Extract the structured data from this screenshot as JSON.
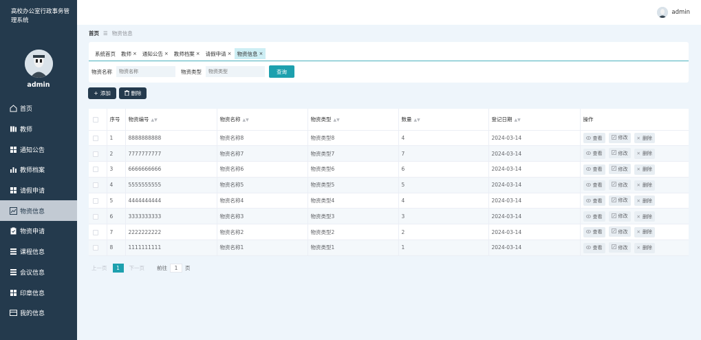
{
  "app": {
    "title": "高校办公室行政事务管理系统"
  },
  "sidebar": {
    "username": "admin",
    "items": [
      {
        "label": "首页",
        "icon": "home-icon",
        "active": false
      },
      {
        "label": "教师",
        "icon": "book-icon",
        "active": false
      },
      {
        "label": "通知公告",
        "icon": "grid-icon",
        "active": false
      },
      {
        "label": "教师档案",
        "icon": "bar-chart-icon",
        "active": false
      },
      {
        "label": "请假申请",
        "icon": "grid-icon",
        "active": false
      },
      {
        "label": "物资信息",
        "icon": "trend-chart-icon",
        "active": true
      },
      {
        "label": "物资申请",
        "icon": "clipboard-icon",
        "active": false
      },
      {
        "label": "课程信息",
        "icon": "list-icon",
        "active": false
      },
      {
        "label": "会议信息",
        "icon": "list-icon",
        "active": false
      },
      {
        "label": "印章信息",
        "icon": "grid-icon",
        "active": false
      },
      {
        "label": "我的信息",
        "icon": "card-icon",
        "active": false
      }
    ]
  },
  "topbar": {
    "username": "admin"
  },
  "breadcrumb": {
    "home": "首页",
    "current": "物资信息"
  },
  "tags": [
    {
      "label": "系统首页",
      "closable": false,
      "active": false
    },
    {
      "label": "教师",
      "closable": true,
      "active": false
    },
    {
      "label": "通知公告",
      "closable": true,
      "active": false
    },
    {
      "label": "教师档案",
      "closable": true,
      "active": false
    },
    {
      "label": "请假申请",
      "closable": true,
      "active": false
    },
    {
      "label": "物资信息",
      "closable": true,
      "active": true
    }
  ],
  "filters": {
    "name_label": "物资名称",
    "name_placeholder": "物资名称",
    "type_label": "物资类型",
    "type_placeholder": "物资类型",
    "search_label": "查询"
  },
  "actions": {
    "add_label": "添加",
    "delete_label": "删除"
  },
  "table": {
    "columns": [
      "序号",
      "物资编号",
      "物资名称",
      "物资类型",
      "数量",
      "登记日期",
      "操作"
    ],
    "rows": [
      {
        "index": "1",
        "code": "8888888888",
        "name": "物资名称8",
        "type": "物资类型8",
        "qty": "4",
        "date": "2024-03-14"
      },
      {
        "index": "2",
        "code": "7777777777",
        "name": "物资名称7",
        "type": "物资类型7",
        "qty": "7",
        "date": "2024-03-14"
      },
      {
        "index": "3",
        "code": "6666666666",
        "name": "物资名称6",
        "type": "物资类型6",
        "qty": "6",
        "date": "2024-03-14"
      },
      {
        "index": "4",
        "code": "5555555555",
        "name": "物资名称5",
        "type": "物资类型5",
        "qty": "5",
        "date": "2024-03-14"
      },
      {
        "index": "5",
        "code": "4444444444",
        "name": "物资名称4",
        "type": "物资类型4",
        "qty": "4",
        "date": "2024-03-14"
      },
      {
        "index": "6",
        "code": "3333333333",
        "name": "物资名称3",
        "type": "物资类型3",
        "qty": "3",
        "date": "2024-03-14"
      },
      {
        "index": "7",
        "code": "2222222222",
        "name": "物资名称2",
        "type": "物资类型2",
        "qty": "2",
        "date": "2024-03-14"
      },
      {
        "index": "8",
        "code": "1111111111",
        "name": "物资名称1",
        "type": "物资类型1",
        "qty": "1",
        "date": "2024-03-14"
      }
    ],
    "ops": {
      "view": "查看",
      "edit": "修改",
      "delete": "删除"
    }
  },
  "pagination": {
    "prev": "上一页",
    "current": "1",
    "next": "下一页",
    "goto_prefix": "前往",
    "goto_value": "1",
    "goto_suffix": "页"
  },
  "colors": {
    "sidebar_bg": "#243a4d",
    "accent": "#1da0ae",
    "page_bg": "#eef5fb"
  }
}
